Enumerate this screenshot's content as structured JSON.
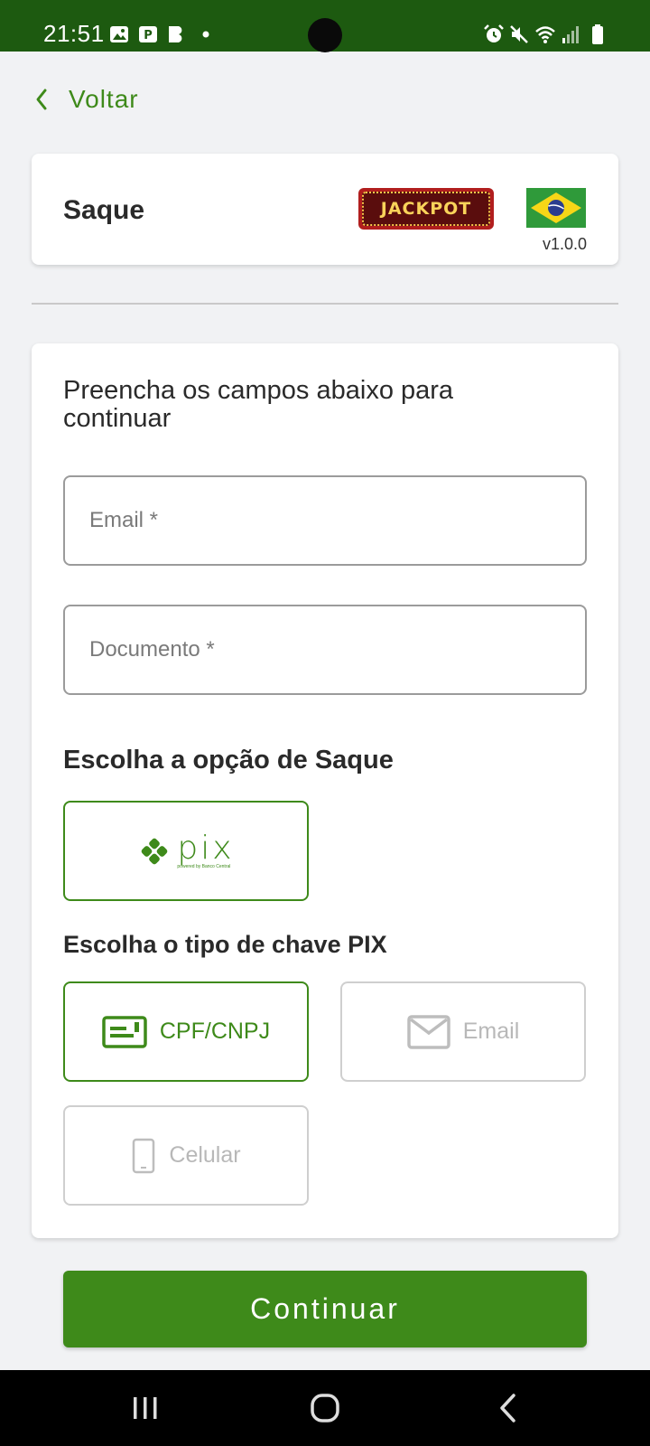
{
  "status_bar": {
    "time": "21:51",
    "left_icons": [
      "image-icon",
      "parking-app-icon",
      "b-app-icon",
      "dot-icon"
    ],
    "right_icons": [
      "alarm-icon",
      "mute-icon",
      "wifi-icon",
      "signal-icon",
      "battery-icon"
    ]
  },
  "nav": {
    "back_label": "Voltar"
  },
  "header": {
    "title": "Saque",
    "brand_logo_text": "JACKPOT",
    "flag": "brazil-flag",
    "version": "v1.0.0"
  },
  "form": {
    "intro": "Preencha os campos abaixo para continuar",
    "email_placeholder": "Email *",
    "email_value": "",
    "document_placeholder": "Documento *",
    "document_value": "",
    "withdraw_option_title": "Escolha a opção de Saque",
    "withdraw_options": [
      {
        "logo_text": "pix",
        "logo_subtext": "powered by Banco Central",
        "selected": true
      }
    ],
    "pix_key_title": "Escolha o tipo de chave PIX",
    "pix_key_types": [
      {
        "label": "CPF/CNPJ",
        "icon": "id-card-icon",
        "selected": true
      },
      {
        "label": "Email",
        "icon": "envelope-icon",
        "selected": false
      },
      {
        "label": "Celular",
        "icon": "phone-icon",
        "selected": false
      }
    ]
  },
  "continue_label": "Continuar",
  "colors": {
    "status_bar": "#1d5a10",
    "accent": "#3e8a1a",
    "background": "#f1f2f4",
    "disabled": "#b8b8b8"
  }
}
